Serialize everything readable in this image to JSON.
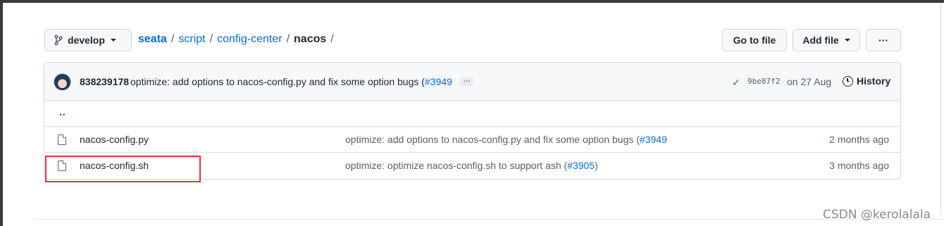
{
  "branch": {
    "name": "develop"
  },
  "breadcrumb": {
    "items": [
      "seata",
      "script",
      "config-center"
    ],
    "current": "nacos",
    "separator": "/"
  },
  "toolbar": {
    "goto_label": "Go to file",
    "addfile_label": "Add file",
    "more_label": "···"
  },
  "commit": {
    "author": "838239178",
    "message_prefix": "optimize: add options to nacos-config.py and fix some option bugs (",
    "pr": "#3949",
    "ellipsis": "…",
    "sha": "9be87f2",
    "when": "on 27 Aug",
    "history_label": "History"
  },
  "parent_link": "..",
  "files": [
    {
      "name": "nacos-config.py",
      "message_prefix": "optimize: add options to nacos-config.py and fix some option bugs (",
      "pr": "#3949",
      "message_suffix": "",
      "age": "2 months ago"
    },
    {
      "name": "nacos-config.sh",
      "message_prefix": "optimize: optimize nacos-config.sh to support ash (",
      "pr": "#3905",
      "message_suffix": ")",
      "age": "3 months ago"
    }
  ],
  "watermark": "CSDN @kerolalala",
  "colors": {
    "link": "#0969da",
    "check": "#1a7f37",
    "highlight": "#e0313b"
  }
}
